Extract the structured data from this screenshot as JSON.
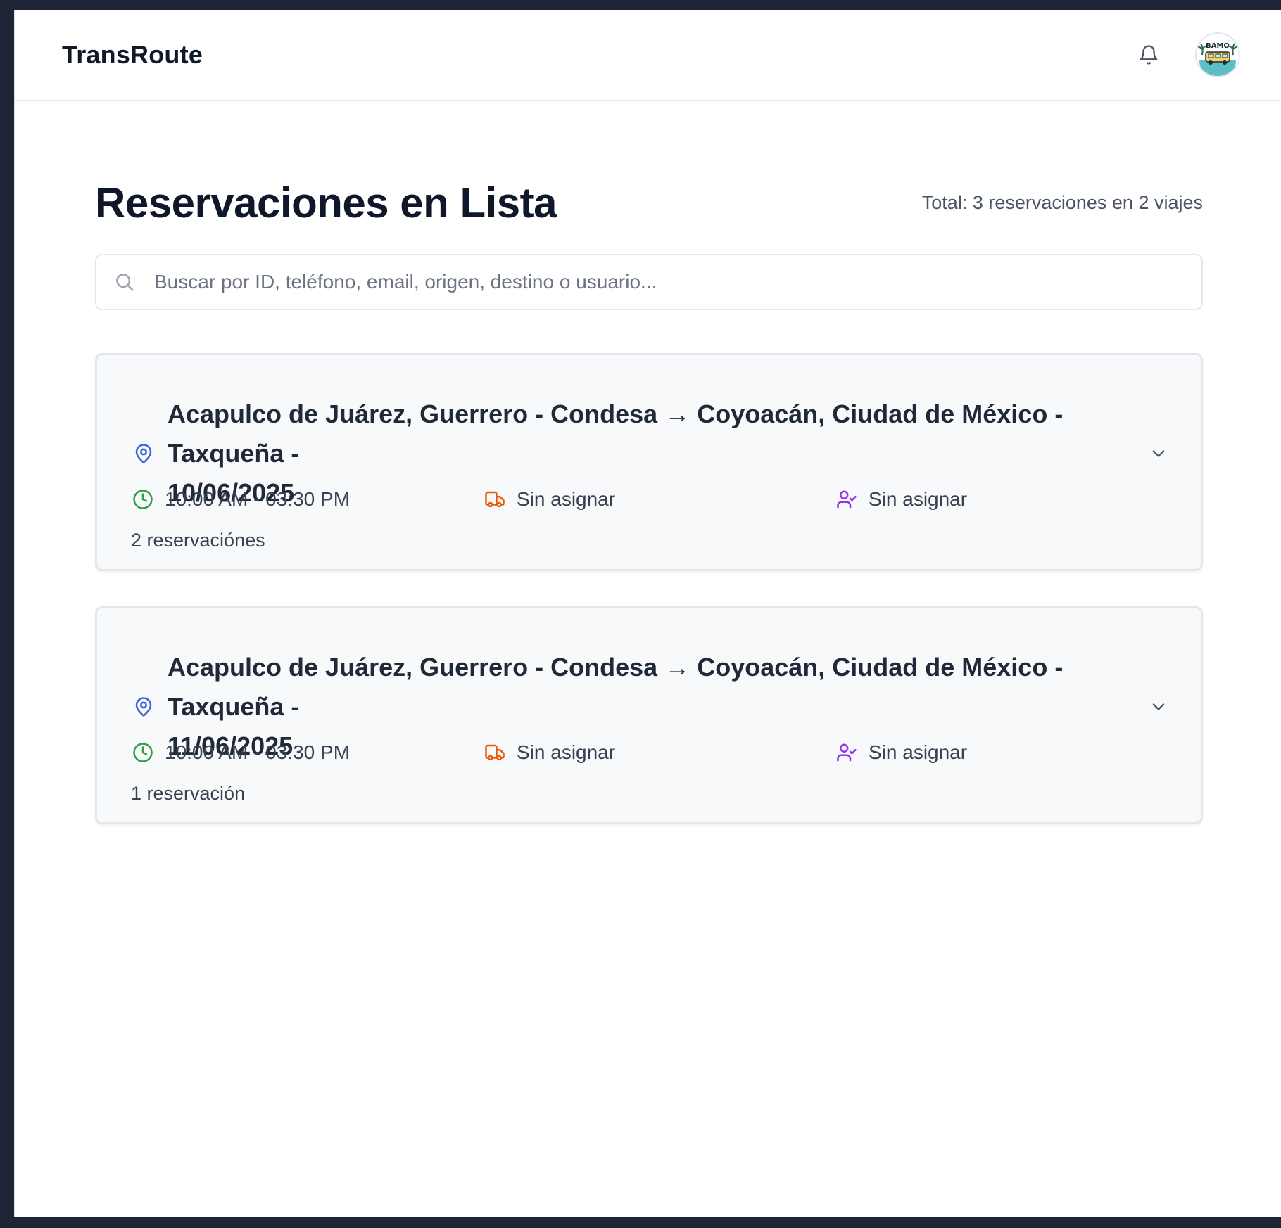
{
  "header": {
    "brand": "TransRoute",
    "notifications_icon": "bell-icon",
    "avatar_text": "BAMO"
  },
  "page": {
    "title": "Reservaciones en Lista",
    "total": "Total: 3 reservaciones en 2 viajes"
  },
  "search": {
    "placeholder": "Buscar por ID, teléfono, email, origen, destino o usuario...",
    "value": ""
  },
  "colors": {
    "pin": "#3b63d8",
    "clock": "#2f9e44",
    "truck": "#ea580c",
    "driver": "#9333ea"
  },
  "trips": [
    {
      "route_line1": "Acapulco de Juárez, Guerrero - Condesa → Coyoacán, Ciudad de México - Taxqueña -",
      "route_line2": "10/06/2025",
      "time": "10:00 AM - 03:30 PM",
      "vehicle": "Sin asignar",
      "driver": "Sin asignar",
      "count": "2 reservaciónes"
    },
    {
      "route_line1": "Acapulco de Juárez, Guerrero - Condesa → Coyoacán, Ciudad de México - Taxqueña -",
      "route_line2": "11/06/2025",
      "time": "10:00 AM - 03:30 PM",
      "vehicle": "Sin asignar",
      "driver": "Sin asignar",
      "count": "1 reservación"
    }
  ]
}
